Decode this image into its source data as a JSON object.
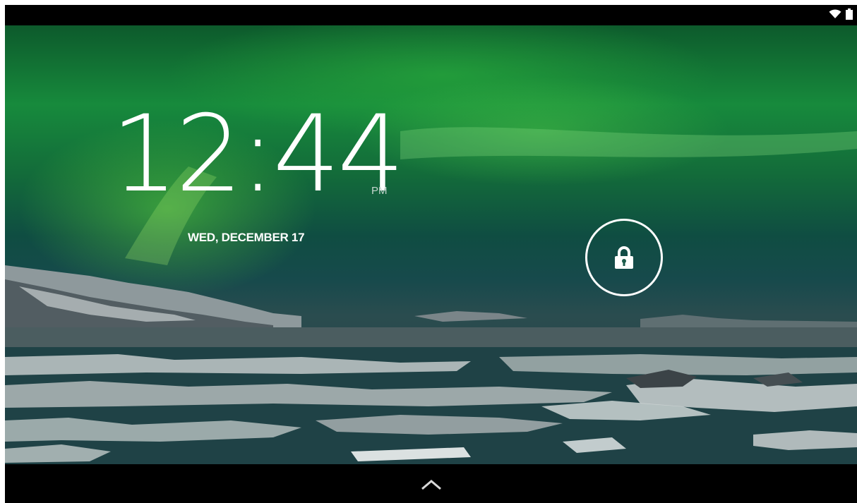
{
  "status_bar": {
    "icons": [
      "wifi-icon",
      "battery-icon"
    ]
  },
  "lockscreen": {
    "time": "12:44",
    "ampm": "PM",
    "date": "WED, DECEMBER 17",
    "lock_icon": "lock-icon"
  },
  "nav_bar": {
    "icon": "chevron-up-icon"
  },
  "colors": {
    "aurora_green": "#178a3c",
    "sky_teal": "#0f4d42",
    "ice_gray": "#b9c2c2",
    "water": "#1f4246"
  }
}
